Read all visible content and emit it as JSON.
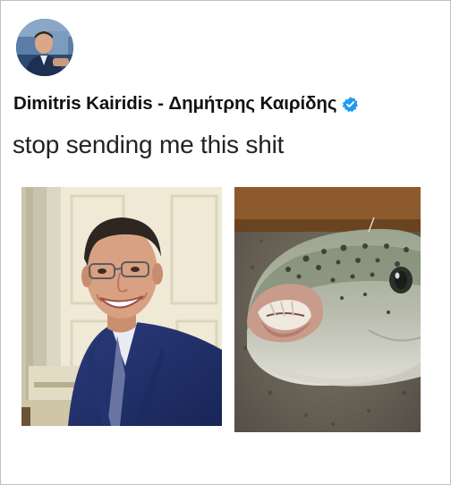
{
  "tweet": {
    "author": {
      "display_name": "Dimitris Kairidis - Δημήτρης Καιρίδης",
      "verified_icon": "verified-badge-icon",
      "verified_color": "#1d9bf0"
    },
    "text": "stop sending me this shit",
    "media": [
      {
        "subject": "man-in-blue-suit-smiling-photo"
      },
      {
        "subject": "pufferfish-head-photo"
      }
    ]
  }
}
